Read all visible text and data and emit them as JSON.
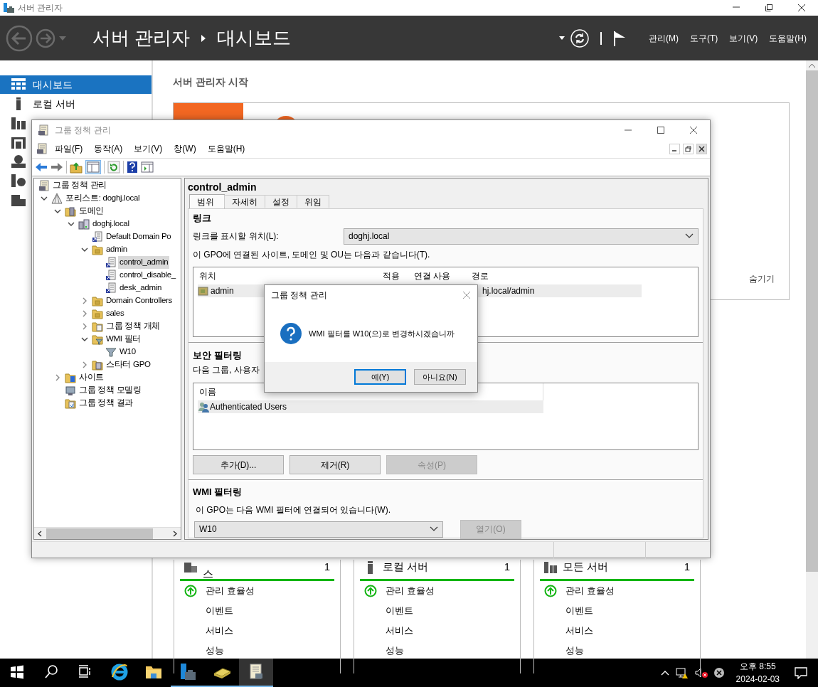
{
  "server_manager": {
    "title": "서버 관리자",
    "breadcrumb": {
      "root": "서버 관리자",
      "page": "대시보드"
    },
    "menu": [
      "관리(M)",
      "도구(T)",
      "보기(V)",
      "도움말(H)"
    ],
    "sidebar": [
      {
        "label": "대시보드",
        "selected": true
      },
      {
        "label": "로컬 서버",
        "selected": false
      },
      {
        "selected": false
      },
      {
        "selected": false
      },
      {
        "selected": false
      },
      {
        "selected": false
      },
      {
        "selected": false
      }
    ],
    "welcome": {
      "heading": "서버 관리자 시작",
      "hide_link": "숨기기"
    },
    "tiles": [
      {
        "title": "스",
        "count": "1",
        "rows": [
          {
            "label": "관리 효율성",
            "healthy": true
          },
          {
            "label": "이벤트",
            "healthy": false
          },
          {
            "label": "서비스",
            "healthy": false
          },
          {
            "label": "성능",
            "healthy": false
          }
        ]
      },
      {
        "title": "로컬 서버",
        "count": "1",
        "rows": [
          {
            "label": "관리 효율성",
            "healthy": true
          },
          {
            "label": "이벤트",
            "healthy": false
          },
          {
            "label": "서비스",
            "healthy": false
          },
          {
            "label": "성능",
            "healthy": false
          }
        ]
      },
      {
        "title": "모든 서버",
        "count": "1",
        "rows": [
          {
            "label": "관리 효율성",
            "healthy": true
          },
          {
            "label": "이벤트",
            "healthy": false
          },
          {
            "label": "서비스",
            "healthy": false
          },
          {
            "label": "성능",
            "healthy": false
          }
        ]
      }
    ]
  },
  "gpmc": {
    "title": "그룹 정책 관리",
    "menu": [
      "파일(F)",
      "동작(A)",
      "보기(V)",
      "창(W)",
      "도움말(H)"
    ],
    "tree": [
      {
        "label": "그룹 정책 관리",
        "kind": "root",
        "selected": false,
        "children": [
          {
            "label": "포리스트: doghj.local",
            "kind": "forest",
            "expanded": true,
            "selected": false,
            "children": [
              {
                "label": "도메인",
                "kind": "domains",
                "expanded": true,
                "selected": false,
                "children": [
                  {
                    "label": "doghj.local",
                    "kind": "domain",
                    "expanded": true,
                    "selected": false,
                    "children": [
                      {
                        "label": "Default Domain Po",
                        "kind": "gpo-link",
                        "selected": false
                      },
                      {
                        "label": "admin",
                        "kind": "ou",
                        "expanded": true,
                        "selected": false,
                        "children": [
                          {
                            "label": "control_admin",
                            "kind": "gpo-link",
                            "selected": true
                          },
                          {
                            "label": "control_disable_",
                            "kind": "gpo-link",
                            "selected": false
                          },
                          {
                            "label": "desk_admin",
                            "kind": "gpo-link",
                            "selected": false
                          }
                        ]
                      },
                      {
                        "label": "Domain Controllers",
                        "kind": "ou",
                        "expanded": false,
                        "selected": false
                      },
                      {
                        "label": "sales",
                        "kind": "ou",
                        "expanded": false,
                        "selected": false
                      },
                      {
                        "label": "그룹 정책 개체",
                        "kind": "gpo-folder",
                        "expanded": false,
                        "selected": false
                      },
                      {
                        "label": "WMI 필터",
                        "kind": "wmi-folder",
                        "expanded": true,
                        "selected": false,
                        "children": [
                          {
                            "label": "W10",
                            "kind": "wmi-filter",
                            "selected": false
                          }
                        ]
                      },
                      {
                        "label": "스타터 GPO",
                        "kind": "starter",
                        "expanded": false,
                        "selected": false
                      }
                    ]
                  }
                ]
              },
              {
                "label": "사이트",
                "kind": "sites",
                "expanded": false,
                "selected": false
              },
              {
                "label": "그룹 정책 모델링",
                "kind": "modeling",
                "selected": false
              },
              {
                "label": "그룹 정책 결과",
                "kind": "results",
                "selected": false
              }
            ]
          }
        ]
      }
    ],
    "gpo": {
      "name": "control_admin",
      "tabs": [
        {
          "label": "범위",
          "selected": true
        },
        {
          "label": "자세히",
          "selected": false
        },
        {
          "label": "설정",
          "selected": false
        },
        {
          "label": "위임",
          "selected": false
        }
      ],
      "links": {
        "heading": "링크",
        "location_label": "링크를 표시할 위치(L):",
        "location_value": "doghj.local",
        "caption": "이 GPO에 연결된 사이트, 도메인 및 OU는 다음과 같습니다(T).",
        "columns": [
          "위치",
          "적용",
          "연결 사용",
          "경로"
        ],
        "rows": [
          {
            "location": "admin",
            "path": "hj.local/admin",
            "selected": true
          }
        ]
      },
      "security": {
        "heading": "보안 필터링",
        "caption": "다음 그룹, 사용자",
        "columns": [
          "이름"
        ],
        "rows": [
          {
            "name": "Authenticated Users",
            "selected": true
          }
        ],
        "buttons": [
          {
            "label": "추가(D)...",
            "disabled": false
          },
          {
            "label": "제거(R)",
            "disabled": false
          },
          {
            "label": "속성(P)",
            "disabled": true
          }
        ]
      },
      "wmi": {
        "heading": "WMI 필터링",
        "caption": "이 GPO는 다음 WMI 필터에 연결되어 있습니다(W).",
        "value": "W10",
        "open_button": {
          "label": "열기(O)",
          "disabled": true
        }
      }
    }
  },
  "dialog": {
    "title": "그룹 정책 관리",
    "message": "WMI 필터를 W10(으)로 변경하시겠습니까",
    "buttons": [
      {
        "label": "예(Y)",
        "default": true
      },
      {
        "label": "아니요(N)",
        "default": false
      }
    ]
  },
  "taskbar": {
    "apps": [
      {
        "running": false,
        "active": false
      },
      {
        "running": false,
        "active": false
      },
      {
        "running": true,
        "active": false
      },
      {
        "running": true,
        "active": false
      },
      {
        "running": true,
        "active": true
      }
    ],
    "clock": {
      "time": "오후 8:55",
      "date": "2024-02-03"
    }
  }
}
